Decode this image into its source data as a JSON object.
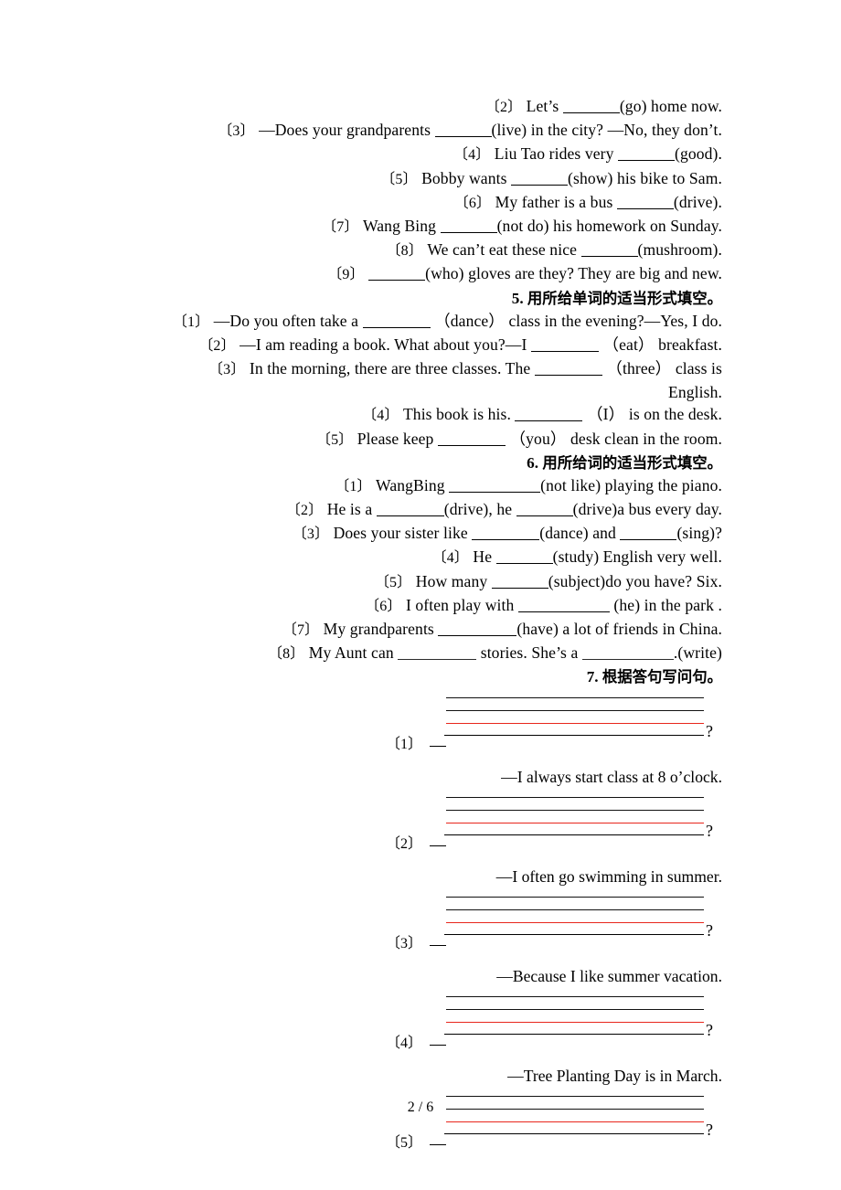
{
  "page": {
    "footer": "2 / 6",
    "red_line_color": "#e8261c",
    "text_color": "#000000"
  },
  "section4_continued": {
    "items": [
      {
        "num": "〔2〕",
        "pre": "Let’s ",
        "blank": "b2",
        "post": "(go) home now."
      },
      {
        "num": "〔3〕",
        "pre": "—Does your grandparents ",
        "blank": "b2",
        "post": "(live) in the city? —No, they don’t."
      },
      {
        "num": "〔4〕",
        "pre": "Liu Tao rides very ",
        "blank": "b2",
        "post": "(good)."
      },
      {
        "num": "〔5〕",
        "pre": "Bobby wants ",
        "blank": "b2",
        "post": "(show) his bike to Sam."
      },
      {
        "num": "〔6〕",
        "pre": "My father is a bus ",
        "blank": "b2",
        "post": "(drive)."
      },
      {
        "num": "〔7〕",
        "pre": "Wang Bing ",
        "blank": "b2",
        "post": "(not do) his homework on Sunday."
      },
      {
        "num": "〔8〕",
        "pre": "We can’t eat these nice ",
        "blank": "b2",
        "post": "(mushroom)."
      },
      {
        "num": "〔9〕",
        "pre": "",
        "blank": "b2",
        "post": "(who) gloves are they? They are big and new."
      }
    ]
  },
  "section5": {
    "heading_num": "5.",
    "heading_cn": "用所给单词的适当形式填空。",
    "items": [
      {
        "num": "〔1〕",
        "pre": "—Do you often take a ",
        "blank": "b3",
        "post": " （dance） class in the evening?—Yes, I do."
      },
      {
        "num": "〔2〕",
        "pre": "—I am reading a book. What about you?—I ",
        "blank": "b3",
        "post": " （eat） breakfast."
      },
      {
        "num": "〔3〕",
        "pre": "In the morning, there are three classes. The ",
        "blank": "b3",
        "post": " （three） class is",
        "wrap_tail": "English."
      },
      {
        "num": "〔4〕",
        "pre": "This book is his. ",
        "blank": "b3",
        "post": " （I） is on the desk."
      },
      {
        "num": "〔5〕",
        "pre": "Please keep ",
        "blank": "b3",
        "post": " （you） desk clean in the room."
      }
    ]
  },
  "section6": {
    "heading_num": "6.",
    "heading_cn": "用所给词的适当形式填空。",
    "items": [
      {
        "num": "〔1〕",
        "pre": "WangBing ",
        "blank": "b5",
        "post": "(not like) playing the piano."
      },
      {
        "num": "〔2〕",
        "pre": "He is a ",
        "blank": "b3",
        "post": "(drive), he ",
        "blank2": "b2",
        "post2": "(drive)a bus every day."
      },
      {
        "num": "〔3〕",
        "pre": "Does your sister like ",
        "blank": "b3",
        "post": "(dance) and ",
        "blank2": "b2",
        "post2": "(sing)?"
      },
      {
        "num": "〔4〕",
        "pre": "He ",
        "blank": "b2",
        "post": "(study) English very well."
      },
      {
        "num": "〔5〕",
        "pre": "How many ",
        "blank": "b2",
        "post": "(subject)do you have? Six."
      },
      {
        "num": "〔6〕",
        "pre": "I often play with ",
        "blank": "b5",
        "post": " (he) in the park ."
      },
      {
        "num": "〔7〕",
        "pre": "My grandparents ",
        "blank": "b4",
        "post": "(have) a lot of friends in China."
      },
      {
        "num": "〔8〕",
        "pre": "My Aunt can ",
        "blank": "b4",
        "post": " stories. She’s a ",
        "blank2": "b5",
        "post2": ".(write)"
      }
    ]
  },
  "section7": {
    "heading_num": "7.",
    "heading_cn": "根据答句写问句。",
    "questions": [
      {
        "num": "〔1〕",
        "qmark": "?",
        "answer": "—I always start class at 8 o’clock."
      },
      {
        "num": "〔2〕",
        "qmark": "?",
        "answer": "—I often go swimming in summer."
      },
      {
        "num": "〔3〕",
        "qmark": "?",
        "answer": "—Because I like summer vacation."
      },
      {
        "num": "〔4〕",
        "qmark": "?",
        "answer": "—Tree Planting Day is in March."
      },
      {
        "num": "〔5〕",
        "qmark": "?",
        "answer": ""
      }
    ]
  }
}
